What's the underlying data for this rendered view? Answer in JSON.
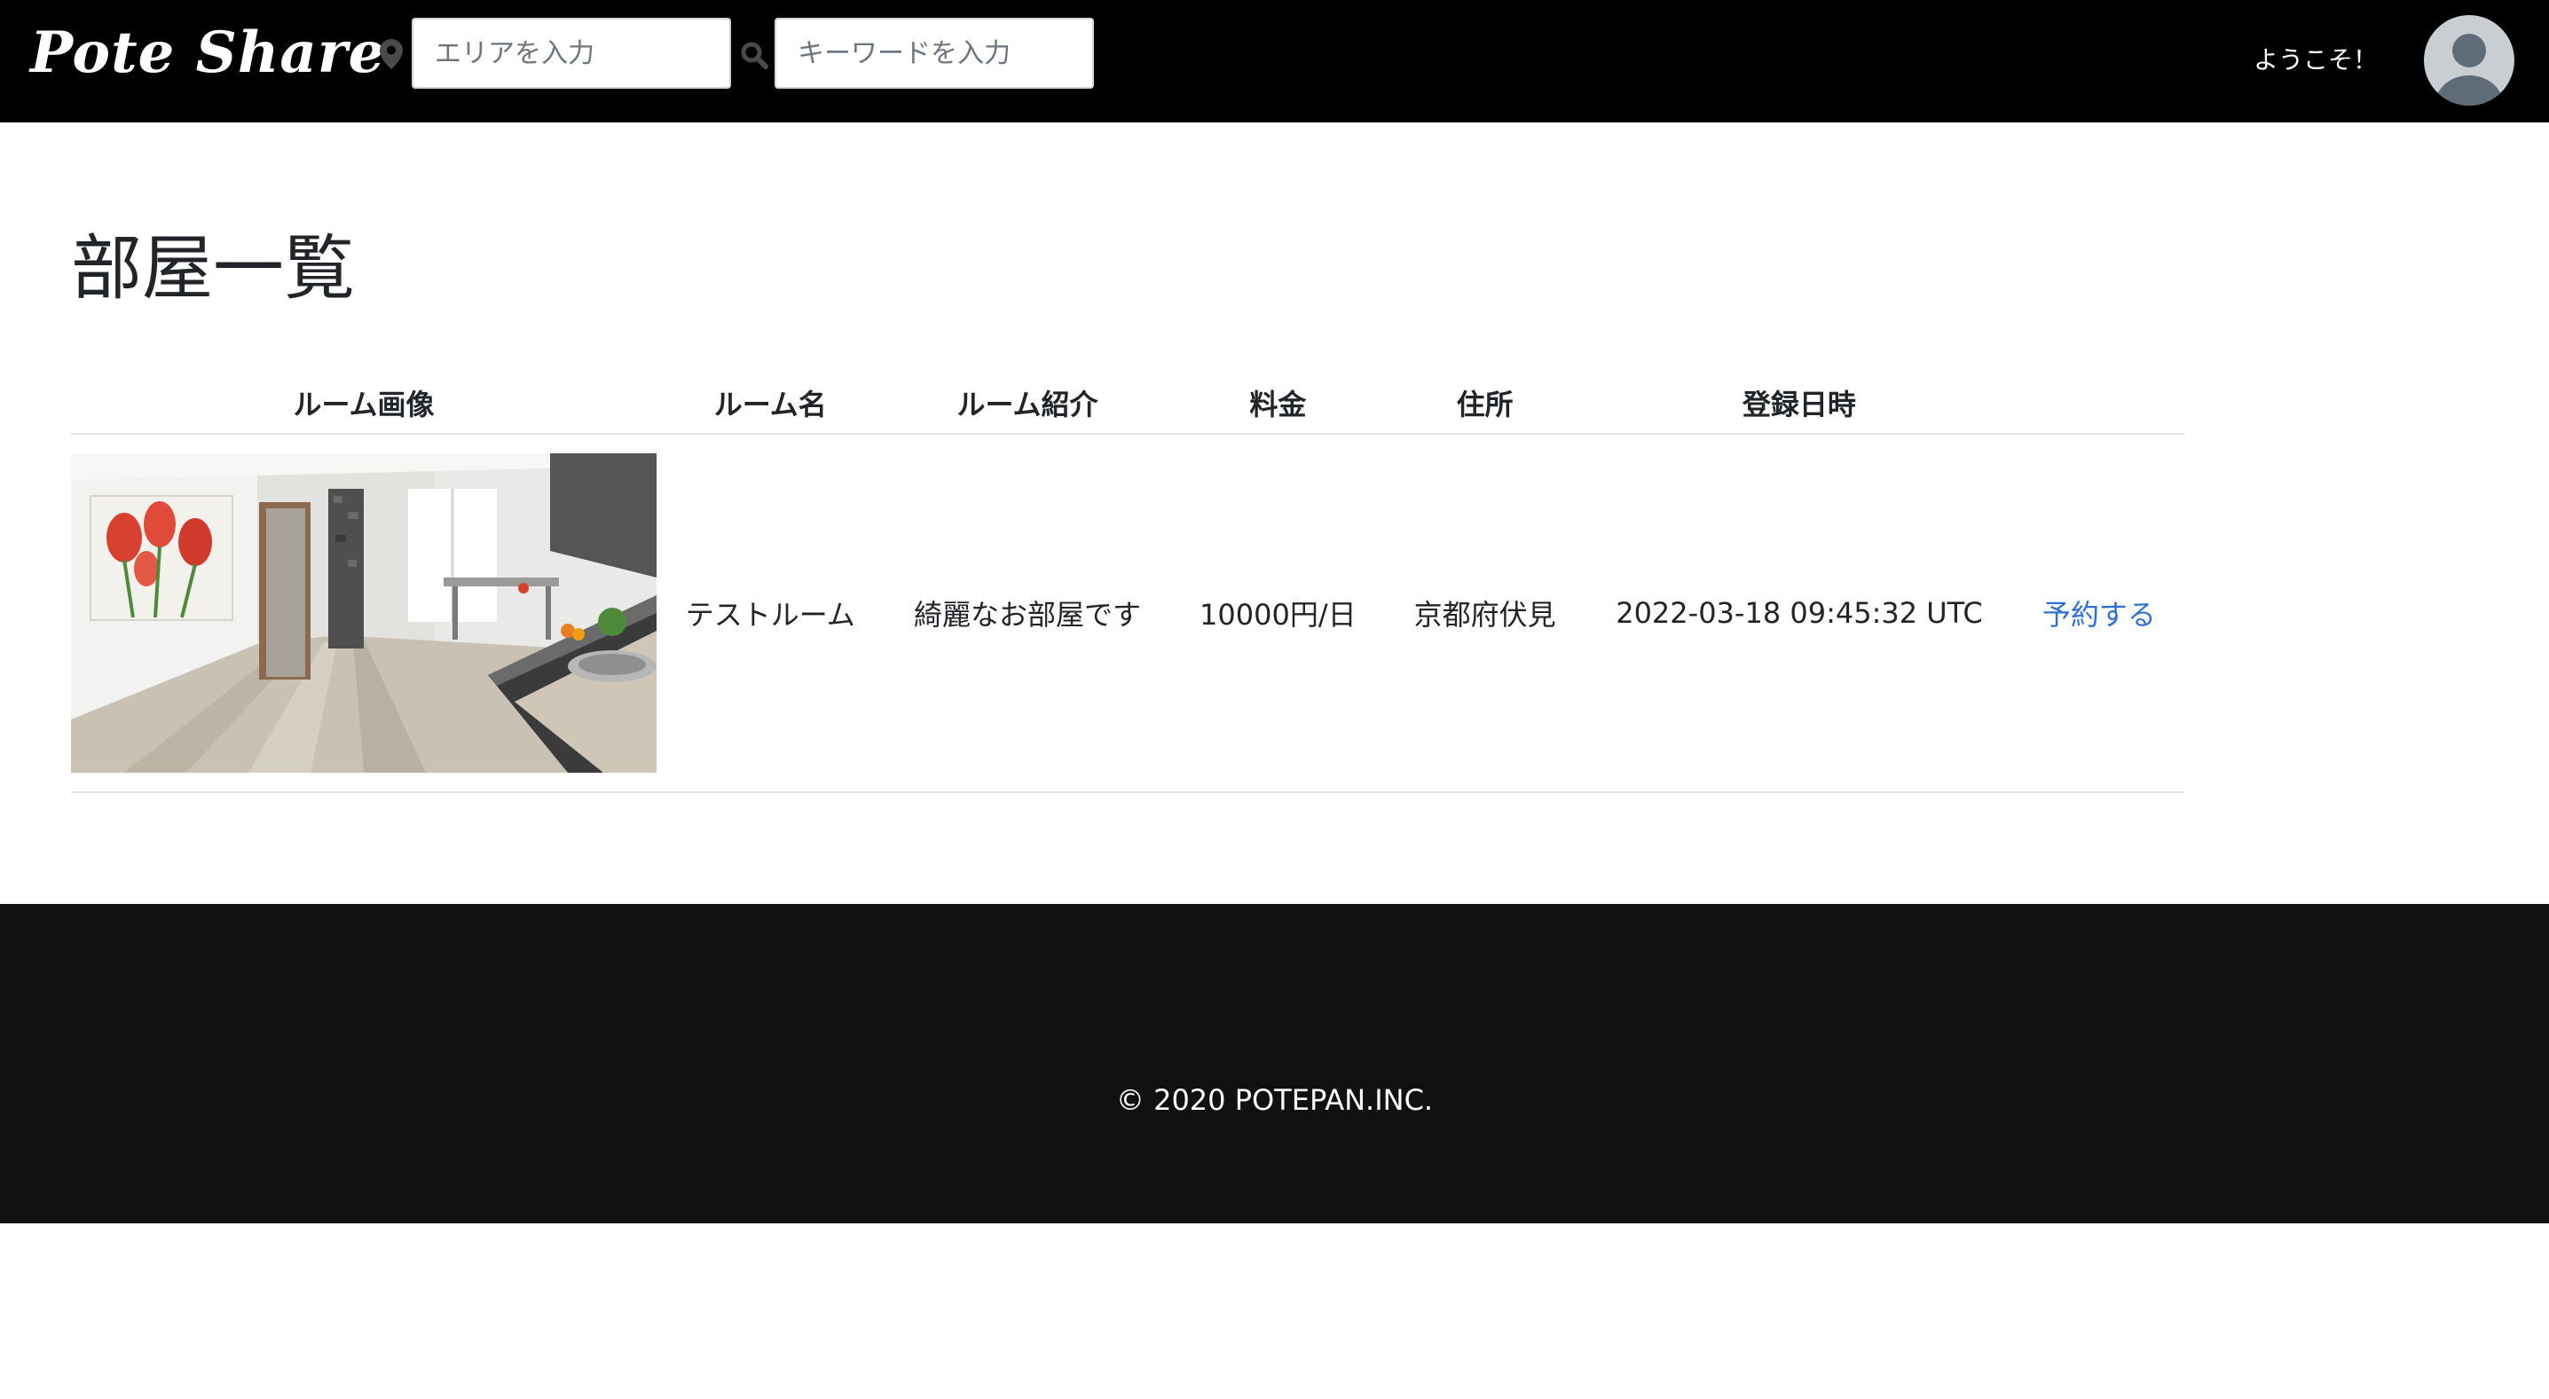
{
  "header": {
    "logo": "Pote Share",
    "area_placeholder": "エリアを入力",
    "keyword_placeholder": "キーワードを入力",
    "welcome": "ようこそ！"
  },
  "main": {
    "title": "部屋一覧",
    "table": {
      "headers": [
        "ルーム画像",
        "ルーム名",
        "ルーム紹介",
        "料金",
        "住所",
        "登録日時",
        ""
      ],
      "rows": [
        {
          "name": "テストルーム",
          "introduction": "綺麗なお部屋です",
          "price": "10000円/日",
          "address": "京都府伏見",
          "created_at": "2022-03-18 09:45:32 UTC",
          "action": "予約する"
        }
      ]
    }
  },
  "footer": {
    "copyright": "© 2020 POTEPAN.INC."
  },
  "colors": {
    "header_bg": "#000000",
    "footer_bg": "#111111",
    "link": "#2f6fd6",
    "border": "#dee2e6"
  }
}
